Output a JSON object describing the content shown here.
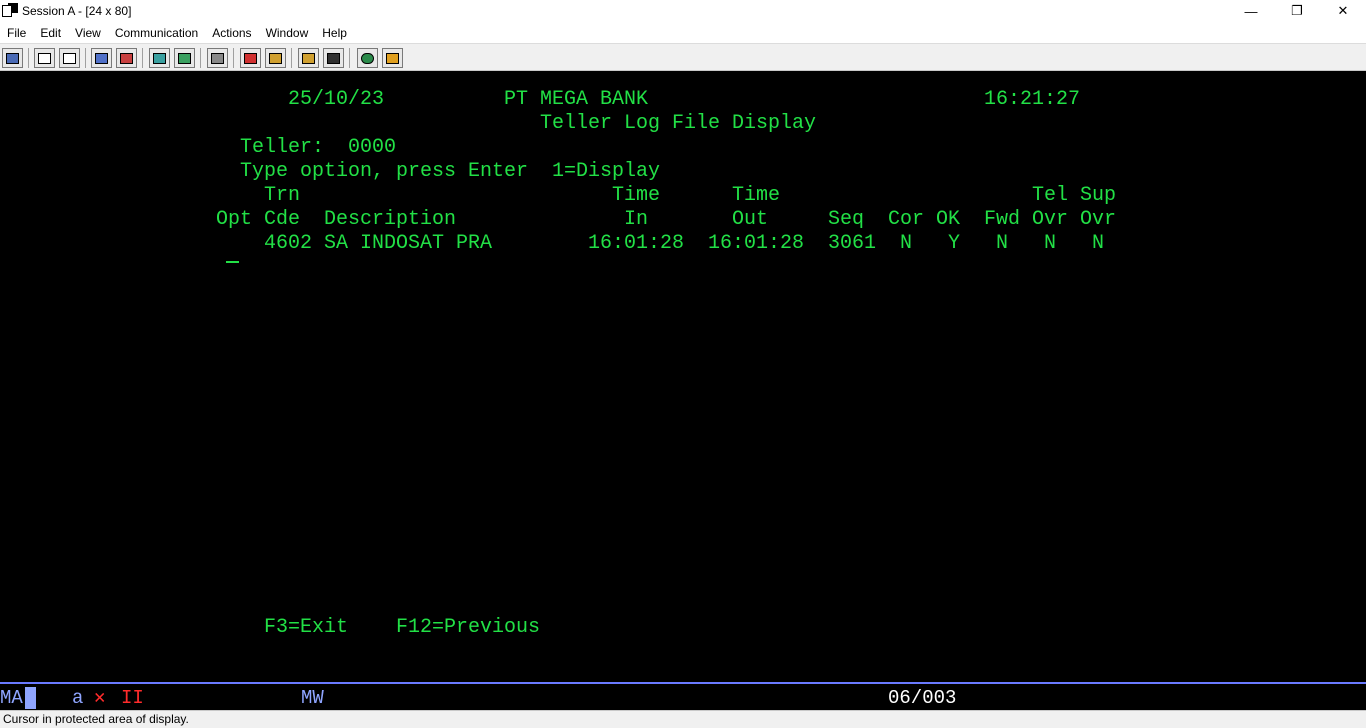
{
  "window": {
    "title": "Session A - [24 x 80]",
    "controls": {
      "minimize": "—",
      "maximize": "❐",
      "close": "✕"
    }
  },
  "menu": [
    "File",
    "Edit",
    "View",
    "Communication",
    "Actions",
    "Window",
    "Help"
  ],
  "toolbar": {
    "icons": [
      "print-screen-icon",
      "copy-icon",
      "paste-icon",
      "send-file-icon",
      "receive-file-icon",
      "display-keypad-icon",
      "keyboard-map-icon",
      "macro-record-icon",
      "macro-stop-icon",
      "macro-play-icon",
      "macro-edit-icon",
      "connect-icon",
      "disconnect-icon",
      "help-icon",
      "settings-icon"
    ]
  },
  "terminal": {
    "date": "25/10/23",
    "bank": "PT MEGA BANK",
    "time": "16:21:27",
    "title": "Teller Log File Display",
    "teller_label": "Teller:",
    "teller_value": "0000",
    "instruction": "Type option, press Enter",
    "option_1": "1=Display",
    "headers": {
      "trn": "Trn",
      "time1": "Time",
      "time2": "Time",
      "tel": "Tel",
      "sup": "Sup",
      "opt": "Opt",
      "cde": "Cde",
      "description": "Description",
      "in": "In",
      "out": "Out",
      "seq": "Seq",
      "cor": "Cor",
      "ok": "OK",
      "fwd": "Fwd",
      "ovr1": "Ovr",
      "ovr2": "Ovr"
    },
    "rows": [
      {
        "code": "4602",
        "description": "SA INDOSAT PRA",
        "time_in": "16:01:28",
        "time_out": "16:01:28",
        "seq": "3061",
        "cor": "N",
        "ok": "Y",
        "fwd": "N",
        "tel_ovr": "N",
        "sup_ovr": "N"
      }
    ],
    "f3": "F3=Exit",
    "f12": "F12=Previous"
  },
  "oia": {
    "ma": "MA",
    "a": "a",
    "x": "✕",
    "ii": "II",
    "mw": "MW",
    "position": "06/003"
  },
  "status": "Cursor in protected area of display.",
  "colors": {
    "terminal_green": "#22e046",
    "oia_blue": "#8fa5ff",
    "oia_red": "#ff2b2b"
  }
}
